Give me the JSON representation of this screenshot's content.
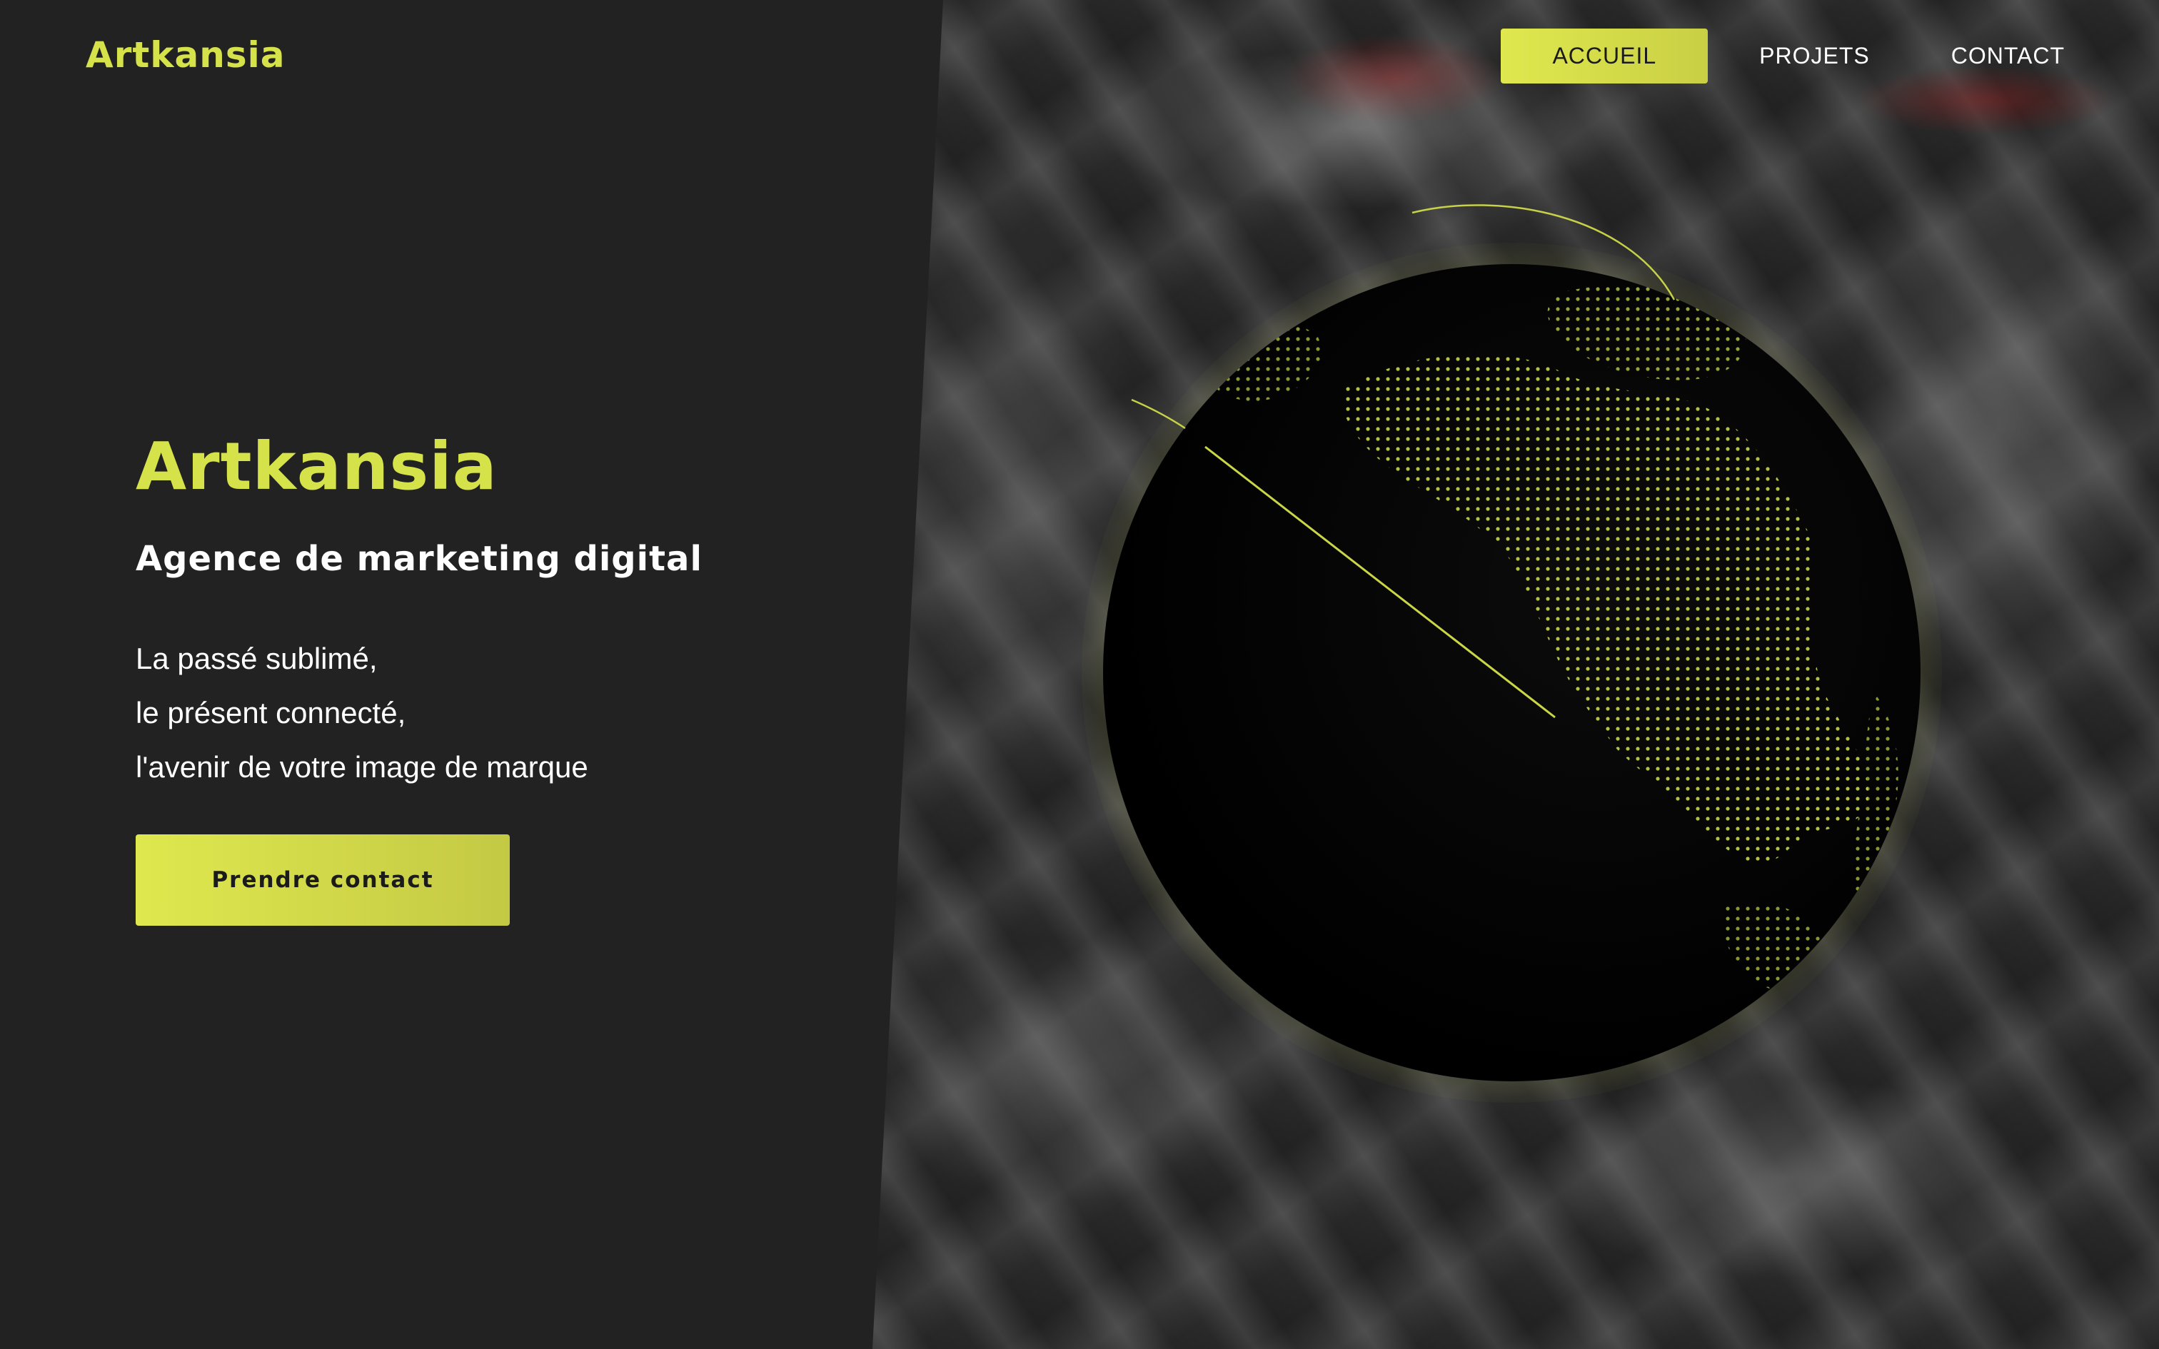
{
  "brand": {
    "logo_text": "Artkansia",
    "accent_color": "#d6e24a"
  },
  "nav": {
    "items": [
      {
        "label": "ACCUEIL",
        "active": true
      },
      {
        "label": "PROJETS",
        "active": false
      },
      {
        "label": "CONTACT",
        "active": false
      }
    ]
  },
  "hero": {
    "title": "Artkansia",
    "subtitle": "Agence de marketing digital",
    "lines": [
      "La passé sublimé,",
      "le présent connecté,",
      "l'avenir de votre image de marque"
    ],
    "cta_label": "Prendre contact"
  },
  "visual": {
    "globe_icon": "globe-icon",
    "background": "crumpled-plastic-texture"
  }
}
